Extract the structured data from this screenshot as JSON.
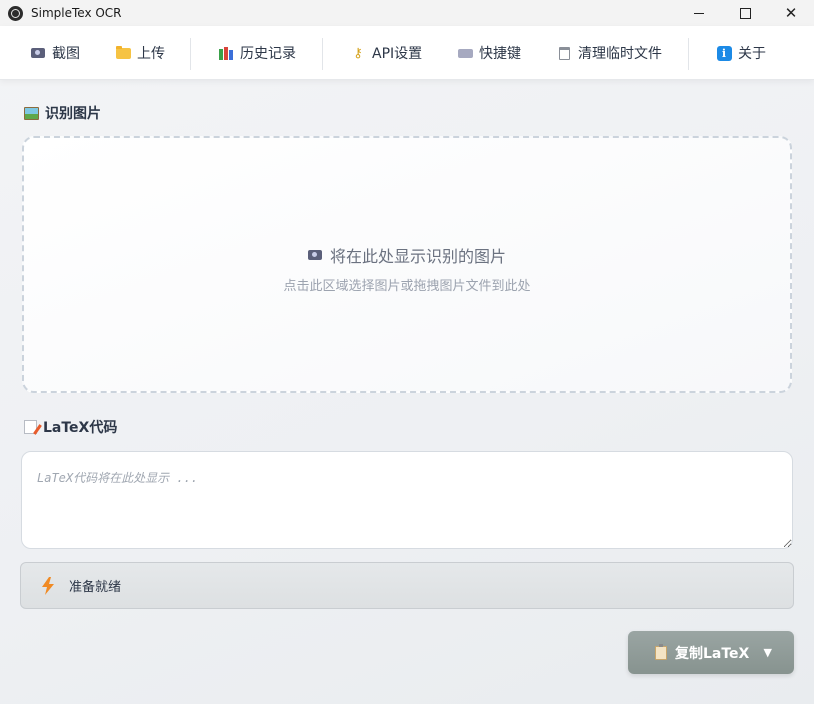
{
  "window": {
    "title": "SimpleTex OCR",
    "close_glyph": "✕"
  },
  "toolbar": {
    "items": [
      {
        "label": "截图",
        "icon": "camera-icon"
      },
      {
        "label": "上传",
        "icon": "folder-icon"
      },
      {
        "label": "历史记录",
        "icon": "books-icon"
      },
      {
        "label": "API设置",
        "icon": "key-icon"
      },
      {
        "label": "快捷键",
        "icon": "keyboard-icon"
      },
      {
        "label": "清理临时文件",
        "icon": "trash-icon"
      },
      {
        "label": "关于",
        "icon": "info-icon"
      }
    ]
  },
  "image_section": {
    "title": "识别图片",
    "icon": "picture-icon",
    "placeholder_main": "将在此处显示识别的图片",
    "placeholder_sub": "点击此区域选择图片或拖拽图片文件到此处"
  },
  "latex_section": {
    "title": "LaTeX代码",
    "icon": "memo-icon",
    "value": "",
    "placeholder": "LaTeX代码将在此处显示 ..."
  },
  "status": {
    "text": "准备就绪",
    "icon": "lightning-icon"
  },
  "copy_button": {
    "label": "复制LaTeX",
    "icon": "clipboard-icon",
    "arrow": "▼"
  },
  "colors": {
    "accent_button": "#8f9b98",
    "status_bg": "#e1e4e6",
    "bolt": "#f08a24",
    "info": "#1c8ae6"
  }
}
